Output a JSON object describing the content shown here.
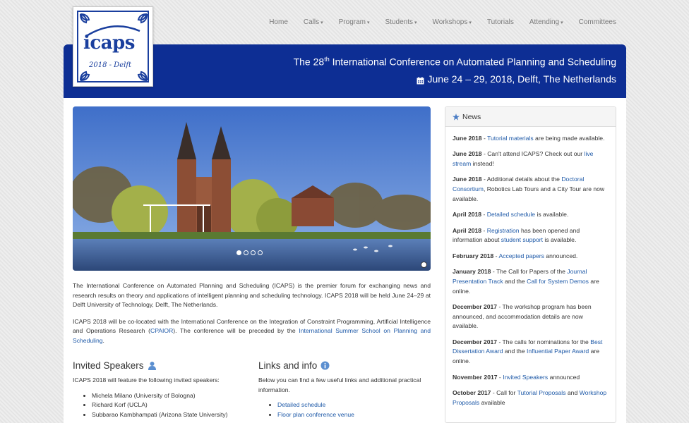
{
  "nav": [
    {
      "label": "Home",
      "caret": false
    },
    {
      "label": "Calls",
      "caret": true
    },
    {
      "label": "Program",
      "caret": true
    },
    {
      "label": "Students",
      "caret": true
    },
    {
      "label": "Workshops",
      "caret": true
    },
    {
      "label": "Tutorials",
      "caret": false
    },
    {
      "label": "Attending",
      "caret": true
    },
    {
      "label": "Committees",
      "caret": false
    }
  ],
  "logo": {
    "word": "icaps",
    "year": "2018 - Delft"
  },
  "banner": {
    "title_pre": "The 28",
    "title_sup": "th",
    "title_post": " International Conference on Automated Planning and Scheduling",
    "date": "June 24 – 29, 2018, Delft, The Netherlands"
  },
  "intro": {
    "p1": "The International Conference on Automated Planning and Scheduling (ICAPS) is the premier forum for exchanging news and research results on theory and applications of intelligent planning and scheduling technology. ICAPS 2018 will be held June 24–29 at Delft University of Technology, Delft, The Netherlands.",
    "p2_a": "ICAPS 2018 will be co-located with the International Conference on the Integration of Constraint Programming, Artificial Intelligence and Operations Research (",
    "p2_link1": "CPAIOR",
    "p2_b": "). The conference will be preceded by the ",
    "p2_link2": "International Summer School on Planning and Scheduling",
    "p2_c": "."
  },
  "speakers": {
    "title": "Invited Speakers",
    "text": "ICAPS 2018 will feature the following invited speakers:",
    "items": [
      "Michela Milano (University of Bologna)",
      "Richard Korf (UCLA)",
      "Subbarao Kambhampati (Arizona State University)"
    ]
  },
  "links": {
    "title": "Links and info",
    "text": "Below you can find a few useful links and additional practical information.",
    "items": [
      "Detailed schedule",
      "Floor plan conference venue"
    ]
  },
  "news": {
    "title": "News",
    "items": [
      [
        {
          "t": "June 2018",
          "s": "date"
        },
        {
          "t": " - ",
          "s": "plain"
        },
        {
          "t": "Tutorial materials",
          "s": "link"
        },
        {
          "t": " are being made available.",
          "s": "plain"
        }
      ],
      [
        {
          "t": "June 2018",
          "s": "date"
        },
        {
          "t": " - Can't attend ICAPS? Check out our ",
          "s": "plain"
        },
        {
          "t": "live stream",
          "s": "link"
        },
        {
          "t": " instead!",
          "s": "plain"
        }
      ],
      [
        {
          "t": "June 2018",
          "s": "date"
        },
        {
          "t": " - Additional details about the ",
          "s": "plain"
        },
        {
          "t": "Doctoral Consortium",
          "s": "link"
        },
        {
          "t": ", Robotics Lab Tours and a City Tour are now available.",
          "s": "plain"
        }
      ],
      [
        {
          "t": "April 2018",
          "s": "date"
        },
        {
          "t": " - ",
          "s": "plain"
        },
        {
          "t": "Detailed schedule",
          "s": "link"
        },
        {
          "t": " is available.",
          "s": "plain"
        }
      ],
      [
        {
          "t": "April 2018",
          "s": "date"
        },
        {
          "t": " - ",
          "s": "plain"
        },
        {
          "t": "Registration",
          "s": "link"
        },
        {
          "t": " has been opened and information about ",
          "s": "plain"
        },
        {
          "t": "student support",
          "s": "link"
        },
        {
          "t": " is available.",
          "s": "plain"
        }
      ],
      [
        {
          "t": "February 2018",
          "s": "date"
        },
        {
          "t": " - ",
          "s": "plain"
        },
        {
          "t": "Accepted papers",
          "s": "link"
        },
        {
          "t": " announced.",
          "s": "plain"
        }
      ],
      [
        {
          "t": "January 2018",
          "s": "date"
        },
        {
          "t": " - The Call for Papers of the ",
          "s": "plain"
        },
        {
          "t": "Journal Presentation Track",
          "s": "link"
        },
        {
          "t": " and the ",
          "s": "plain"
        },
        {
          "t": "Call for System Demos",
          "s": "link"
        },
        {
          "t": " are online.",
          "s": "plain"
        }
      ],
      [
        {
          "t": "December 2017",
          "s": "date"
        },
        {
          "t": " - The workshop program has been announced, and accommodation details are now available.",
          "s": "plain"
        }
      ],
      [
        {
          "t": "December 2017",
          "s": "date"
        },
        {
          "t": " - The calls for nominations for the ",
          "s": "plain"
        },
        {
          "t": "Best Dissertation Award",
          "s": "link"
        },
        {
          "t": " and the ",
          "s": "plain"
        },
        {
          "t": "Influential Paper Award",
          "s": "link"
        },
        {
          "t": " are online.",
          "s": "plain"
        }
      ],
      [
        {
          "t": "November 2017",
          "s": "date"
        },
        {
          "t": " - ",
          "s": "plain"
        },
        {
          "t": "Invited Speakers",
          "s": "link"
        },
        {
          "t": " announced",
          "s": "plain"
        }
      ],
      [
        {
          "t": "October 2017",
          "s": "date"
        },
        {
          "t": " - Call for ",
          "s": "plain"
        },
        {
          "t": "Tutorial Proposals",
          "s": "link"
        },
        {
          "t": " and ",
          "s": "plain"
        },
        {
          "t": "Workshop Proposals",
          "s": "link"
        },
        {
          "t": " available",
          "s": "plain"
        }
      ]
    ]
  },
  "carousel": {
    "slides": 4,
    "active": 0
  },
  "colors": {
    "brand": "#0d2e94",
    "link": "#1f5aa8"
  },
  "icons": {
    "calendar": "calendar-icon",
    "user": "user-icon",
    "info": "info-icon",
    "star": "star-icon"
  }
}
